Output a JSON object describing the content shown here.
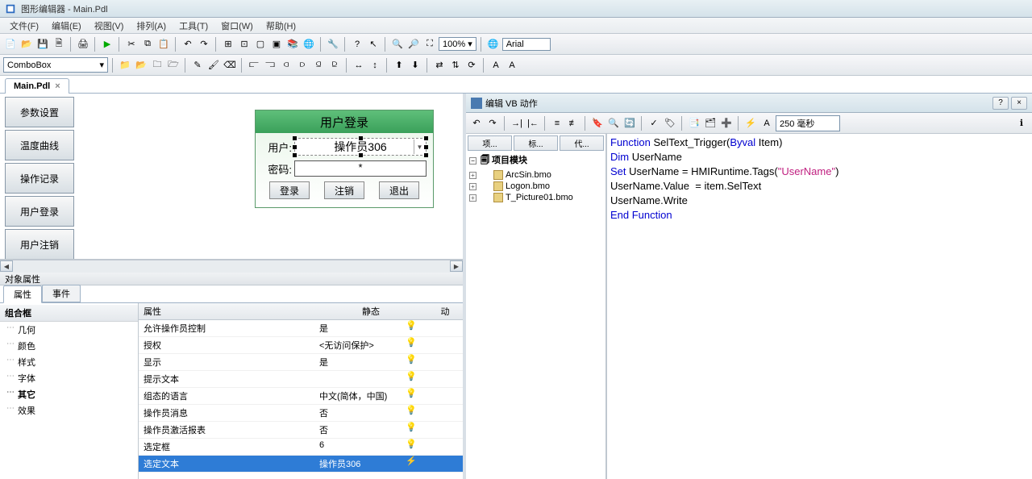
{
  "title": "图形编辑器 - Main.Pdl",
  "menus": [
    "文件(F)",
    "编辑(E)",
    "视图(V)",
    "排列(A)",
    "工具(T)",
    "窗口(W)",
    "帮助(H)"
  ],
  "zoom": "100%",
  "font": "Arial",
  "combo": "ComboBox",
  "doc_tab": "Main.Pdl",
  "side_buttons": [
    "参数设置",
    "温度曲线",
    "操作记录",
    "用户登录",
    "用户注销"
  ],
  "login": {
    "title": "用户登录",
    "user_label": "用户:",
    "user_value": "操作员306",
    "pwd_label": "密码:",
    "pwd_value": "*",
    "btn_login": "登录",
    "btn_logout": "注销",
    "btn_exit": "退出"
  },
  "props": {
    "panel_title": "对象属性",
    "tab_props": "属性",
    "tab_events": "事件",
    "category": "组合框",
    "tree": [
      "几何",
      "颜色",
      "样式",
      "字体",
      "其它",
      "效果"
    ],
    "tree_bold_index": 4,
    "cols": {
      "name": "属性",
      "static": "静态",
      "dyn": "动"
    },
    "rows": [
      {
        "name": "允许操作员控制",
        "val": "是"
      },
      {
        "name": "授权",
        "val": "<无访问保护>"
      },
      {
        "name": "显示",
        "val": "是"
      },
      {
        "name": "提示文本",
        "val": ""
      },
      {
        "name": "组态的语言",
        "val": "中文(简体，中国)"
      },
      {
        "name": "操作员消息",
        "val": "否"
      },
      {
        "name": "操作员激活报表",
        "val": "否"
      },
      {
        "name": "选定框",
        "val": "6"
      },
      {
        "name": "选定文本",
        "val": "操作员306",
        "sel": true
      }
    ]
  },
  "right": {
    "title": "编辑 VB 动作",
    "tree_tabs": [
      "项...",
      "标...",
      "代..."
    ],
    "root": "项目模块",
    "files": [
      "ArcSin.bmo",
      "Logon.bmo",
      "T_Picture01.bmo"
    ],
    "time": "250 毫秒"
  },
  "code": {
    "l1a": "Function",
    "l1b": " SelText_Trigger(",
    "l1c": "Byval",
    "l1d": " Item)",
    "l2a": "Dim",
    "l2b": " UserName",
    "l3a": "Set",
    "l3b": " UserName = HMIRuntime.Tags(",
    "l3c": "\"UserName\"",
    "l3d": ")",
    "l4": "UserName.Value  = item.SelText",
    "l5": "UserName.Write",
    "l6": "End Function"
  }
}
